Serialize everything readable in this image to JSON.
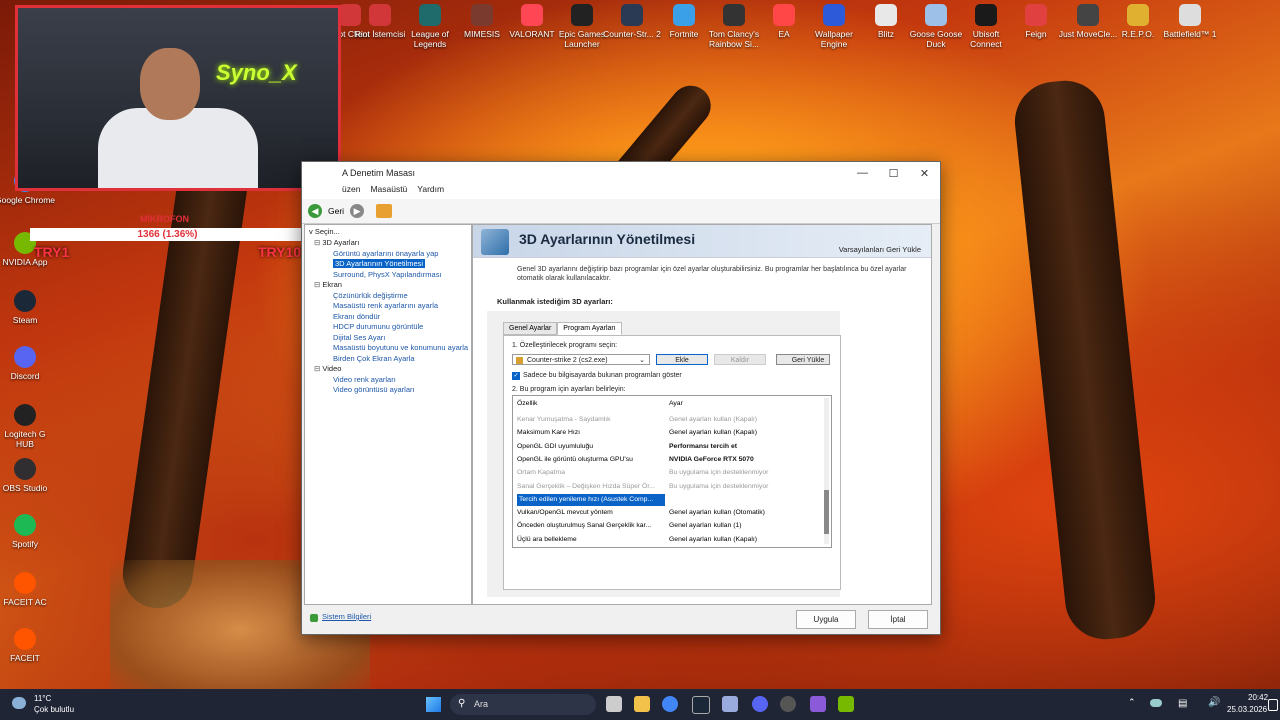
{
  "desktop": {
    "top_icons": [
      {
        "label": "Riot Client",
        "icon": "riot-icon",
        "color": "#d13639"
      },
      {
        "label": "Riot İstemcisi",
        "icon": "riot-icon",
        "color": "#d13639"
      },
      {
        "label": "League of Legends",
        "icon": "lol-icon",
        "color": "#1f6a6a"
      },
      {
        "label": "MIMESIS",
        "icon": "mimesis-icon",
        "color": "#7a3b2e"
      },
      {
        "label": "VALORANT",
        "icon": "valorant-icon",
        "color": "#ff4655"
      },
      {
        "label": "Epic Games Launcher",
        "icon": "epic-icon",
        "color": "#222222"
      },
      {
        "label": "Counter-Str... 2",
        "icon": "cs-icon",
        "color": "#2a3a55"
      },
      {
        "label": "Fortnite",
        "icon": "fortnite-icon",
        "color": "#3aa0e8"
      },
      {
        "label": "Tom Clancy's Rainbow Si...",
        "icon": "r6-icon",
        "color": "#333333"
      },
      {
        "label": "EA",
        "icon": "ea-icon",
        "color": "#ff4747"
      },
      {
        "label": "Wallpaper Engine",
        "icon": "wallpaper-icon",
        "color": "#2c5ad8"
      },
      {
        "label": "Blitz",
        "icon": "blitz-icon",
        "color": "#e8e8e8"
      },
      {
        "label": "Goose Goose Duck",
        "icon": "ggd-icon",
        "color": "#9cc0e8"
      },
      {
        "label": "Ubisoft Connect",
        "icon": "ubisoft-icon",
        "color": "#1a1a1a"
      },
      {
        "label": "Feign",
        "icon": "feign-icon",
        "color": "#e04040"
      },
      {
        "label": "Just MoveCle...",
        "icon": "just-icon",
        "color": "#444444"
      },
      {
        "label": "R.E.P.O.",
        "icon": "repo-icon",
        "color": "#e0b030"
      },
      {
        "label": "Battlefield™ 1",
        "icon": "bf-icon",
        "color": "#dddddd"
      }
    ],
    "left_icons": [
      {
        "label": "Google Chrome",
        "icon": "chrome-icon",
        "color": "#4285f4"
      },
      {
        "label": "NVIDIA App",
        "icon": "nvidia-icon",
        "color": "#76b900"
      },
      {
        "label": "Steam",
        "icon": "steam-icon",
        "color": "#1b2838"
      },
      {
        "label": "Discord",
        "icon": "discord-icon",
        "color": "#5865f2"
      },
      {
        "label": "Logitech G HUB",
        "icon": "logitech-icon",
        "color": "#222222"
      },
      {
        "label": "OBS Studio",
        "icon": "obs-icon",
        "color": "#302e31"
      },
      {
        "label": "Spotify",
        "icon": "spotify-icon",
        "color": "#1db954"
      },
      {
        "label": "FACEIT AC",
        "icon": "faceit-icon",
        "color": "#ff5500"
      },
      {
        "label": "FACEIT",
        "icon": "faceit-icon",
        "color": "#ff5500"
      }
    ]
  },
  "overlay": {
    "neon_sign": "Syno_X",
    "mic_label": "MİKROFON",
    "mic_value": "1366 (1.36%)",
    "try_left": "TRY1",
    "try_right": "TRY10000"
  },
  "window": {
    "title": "A Denetim Masası",
    "menu": [
      "üzen",
      "Masaüstü",
      "Yardım"
    ],
    "back_label": "Geri",
    "task_label": "v Seçin...",
    "tree": [
      {
        "type": "cat",
        "label": "3D Ayarları"
      },
      {
        "type": "item",
        "label": "Görüntü ayarlarını önayarla yap"
      },
      {
        "type": "item",
        "label": "3D Ayarlarının Yönetilmesi",
        "selected": true
      },
      {
        "type": "item",
        "label": "Surround, PhysX Yapılandırması"
      },
      {
        "type": "cat",
        "label": "Ekran"
      },
      {
        "type": "item",
        "label": "Çözünürlük değiştirme"
      },
      {
        "type": "item",
        "label": "Masaüstü renk ayarlarını ayarla"
      },
      {
        "type": "item",
        "label": "Ekranı döndür"
      },
      {
        "type": "item",
        "label": "HDCP durumunu görüntüle"
      },
      {
        "type": "item",
        "label": "Dijital Ses Ayarı"
      },
      {
        "type": "item",
        "label": "Masaüstü boyutunu ve konumunu ayarla"
      },
      {
        "type": "item",
        "label": "Birden Çok Ekran Ayarla"
      },
      {
        "type": "cat",
        "label": "Video"
      },
      {
        "type": "item",
        "label": "Video renk ayarları"
      },
      {
        "type": "item",
        "label": "Video görüntüsü ayarları"
      }
    ],
    "heading": "3D Ayarlarının Yönetilmesi",
    "restore_defaults": "Varsayılanları Geri Yükle",
    "description": "Genel 3D ayarlarını değiştirip bazı programlar için özel ayarlar oluşturabilirsiniz. Bu programlar her başlatılınca bu özel ayarlar otomatik olarak kullanılacaktır.",
    "section_title": "Kullanmak istediğim 3D ayarları:",
    "tabs": [
      "Genel Ayarlar",
      "Program Ayarları"
    ],
    "step1_label": "1. Özelleştirilecek programı seçin:",
    "program_selected": "Counter-strike 2 (cs2.exe)",
    "add_button": "Ekle",
    "remove_button": "Kaldır",
    "restore_button": "Geri Yükle",
    "checkbox_label": "Sadece bu bilgisayarda bulunan programları göster",
    "step2_label": "2. Bu program için ayarları belirleyin:",
    "grid_headers": {
      "feature": "Özellik",
      "setting": "Ayar"
    },
    "grid_rows": [
      {
        "feature": "Kenar Yumuşatma - Saydamlık",
        "setting": "Genel ayarları kullan (Kapalı)",
        "style": "grey"
      },
      {
        "feature": "Maksimum Kare Hızı",
        "setting": "Genel ayarları kullan (Kapalı)",
        "style": ""
      },
      {
        "feature": "OpenGL GDI uyumluluğu",
        "setting": "Performansı tercih et",
        "style": "bold"
      },
      {
        "feature": "OpenGL ile görüntü oluşturma GPU'su",
        "setting": "NVIDIA GeForce RTX 5070",
        "style": "bold"
      },
      {
        "feature": "Ortam Kapatma",
        "setting": "Bu uygulama için desteklenmiyor",
        "style": "grey"
      },
      {
        "feature": "Sanal Gerçeklik – Değişken Hızda Süper Ör...",
        "setting": "Bu uygulama için desteklenmiyor",
        "style": "grey"
      },
      {
        "feature": "Tercih edilen yenileme hızı (Asustek Comp...",
        "setting": "",
        "style": "selrow"
      },
      {
        "feature": "Vulkan/OpenGL mevcut yöntem",
        "setting": "Genel ayarları kullan (Otomatik)",
        "style": ""
      },
      {
        "feature": "Önceden oluşturulmuş Sanal Gerçeklik kar...",
        "setting": "Genel ayarları kullan (1)",
        "style": ""
      },
      {
        "feature": "Üçlü ara bellekleme",
        "setting": "Genel ayarları kullan (Kapalı)",
        "style": ""
      }
    ],
    "system_info": "Sistem Bilgileri",
    "apply_button": "Uygula",
    "cancel_button": "İptal"
  },
  "taskbar": {
    "weather_temp": "11°C",
    "weather_desc": "Çok bulutlu",
    "search_placeholder": "Ara",
    "time": "20:42",
    "date": "25.03.2026"
  }
}
